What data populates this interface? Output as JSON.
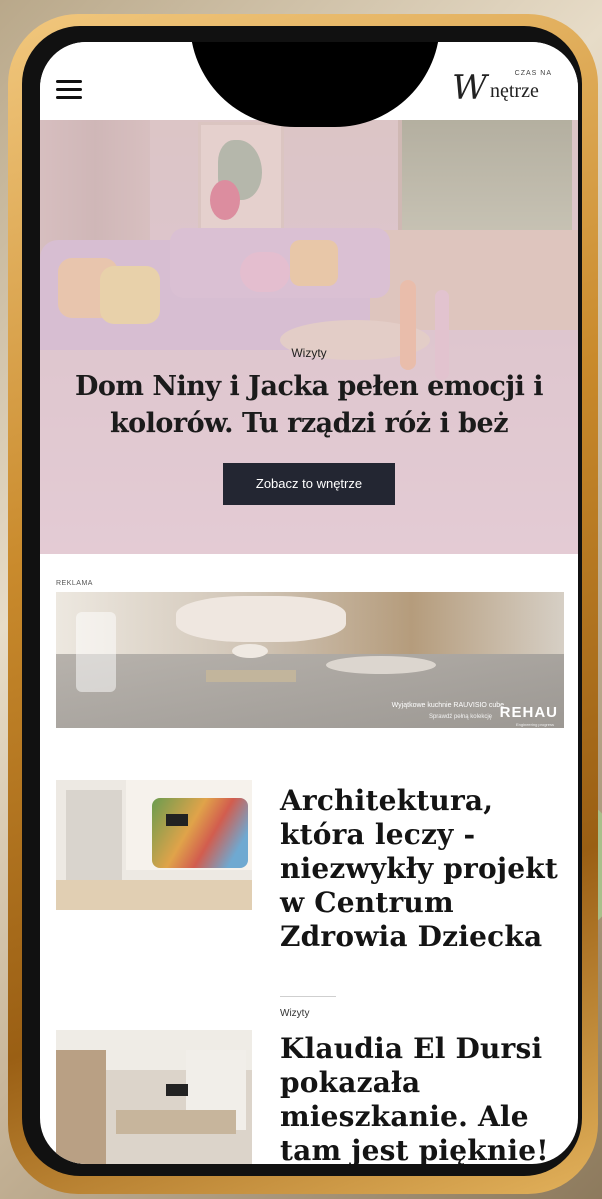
{
  "header": {
    "logo_script": "W",
    "logo_rest": "nętrze",
    "logo_small": "CZAS NA"
  },
  "hero": {
    "category": "Wizyty",
    "title": "Dom Niny i Jacka pełen emocji i kolorów. Tu rządzi róż i beż",
    "cta": "Zobacz to wnętrze"
  },
  "ad": {
    "label": "REKLAMA",
    "line1": "Wyjątkowe kuchnie RAUVISIO cube",
    "line2": "Sprawdź pełną kolekcję",
    "brand": "REHAU",
    "brand_sub": "Engineering progress"
  },
  "articles": [
    {
      "title": "Architektura, która leczy - niezwykły projekt w Centrum Zdrowia Dziecka"
    },
    {
      "category": "Wizyty",
      "title": "Klaudia El Dursi pokazała mieszkanie. Ale tam jest pięknie!"
    }
  ],
  "colors": {
    "frame": "#c98a2c",
    "cta_bg": "#232632",
    "hero_tint": "#e2c8d4"
  },
  "icons": [
    "menu-icon",
    "logo"
  ]
}
